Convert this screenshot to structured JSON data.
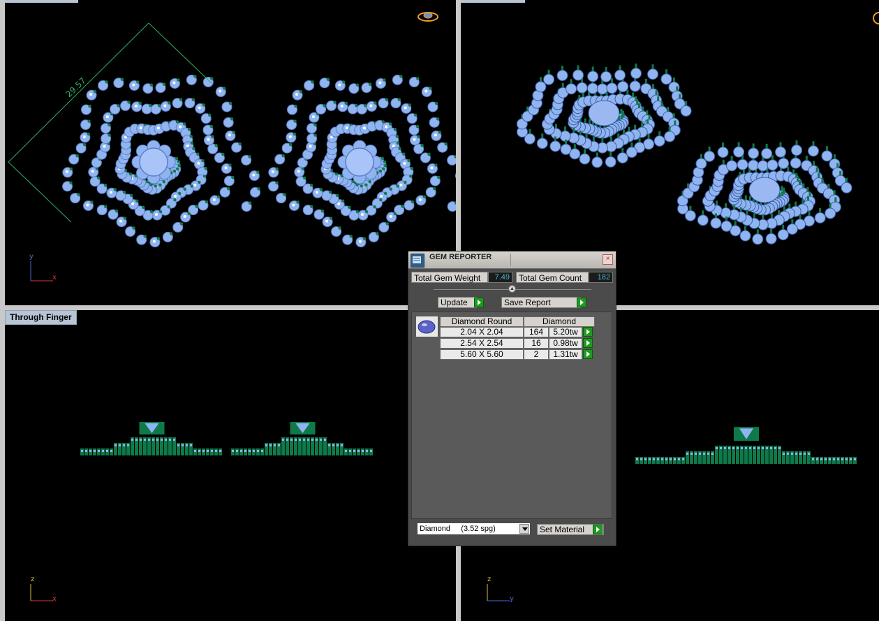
{
  "viewports": {
    "bottom_left_label": "Through Finger",
    "top_left": {
      "dimension": "29.57",
      "axis_v": "y",
      "axis_h": "x"
    },
    "bottom_left": {
      "axis_v": "z",
      "axis_h": "x"
    },
    "bottom_right": {
      "axis_v": "z",
      "axis_h": "y"
    }
  },
  "gem_reporter": {
    "title": "GEM REPORTER",
    "close": "×",
    "total_weight_label": "Total Gem Weight",
    "total_weight_value": "7.49",
    "total_count_label": "Total Gem Count",
    "total_count_value": "182",
    "update_label": "Update",
    "save_report_label": "Save Report",
    "table_headers": {
      "shape": "Diamond Round",
      "material": "Diamond"
    },
    "rows": [
      {
        "size": "2.04 X 2.04",
        "count": "164",
        "weight": "5.20tw"
      },
      {
        "size": "2.54 X 2.54",
        "count": "16",
        "weight": "0.98tw"
      },
      {
        "size": "5.60 X 5.60",
        "count": "2",
        "weight": "1.31tw"
      }
    ],
    "material_select": "Diamond     (3.52 spg)",
    "set_material_label": "Set Material"
  },
  "colors": {
    "gem_blue": "#8fb4f0",
    "prong_green": "#0e7a4a",
    "value_cyan": "#3fb5c9",
    "go_green": "#1f9a1f"
  }
}
